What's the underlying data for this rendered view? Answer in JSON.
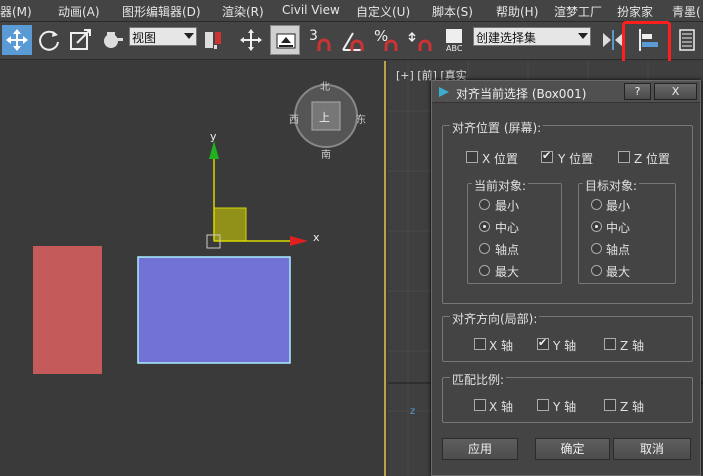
{
  "menu": [
    "器(M)",
    "动画(A)",
    "图形编辑器(D)",
    "渲染(R)",
    "Civil View",
    "自定义(U)",
    "脚本(S)",
    "帮助(H)",
    "渲梦工厂",
    "扮家家",
    "青墨("
  ],
  "toolbar": {
    "view_combo": "视图",
    "selection_set_combo": "创建选择集",
    "snap_3": "3",
    "snap_pct": "%",
    "abc_label": "ABC"
  },
  "viewport": {
    "label": "[+] [前] [真实",
    "viewcube": {
      "top": "北",
      "left": "西",
      "right": "东",
      "bottom": "南",
      "face": "上"
    },
    "axis_x": "x",
    "axis_y": "y",
    "axis_z": "z"
  },
  "dialog": {
    "title": "对齐当前选择 (Box001)",
    "help_btn": "?",
    "close_btn": "X",
    "align_position_group": "对齐位置 (屏幕):",
    "x_pos": "X 位置",
    "y_pos": "Y 位置",
    "z_pos": "Z 位置",
    "x_pos_checked": false,
    "y_pos_checked": true,
    "z_pos_checked": false,
    "current_object_group": "当前对象:",
    "target_object_group": "目标对象:",
    "current_options": [
      "最小",
      "中心",
      "轴点",
      "最大"
    ],
    "current_selected": "中心",
    "target_options": [
      "最小",
      "中心",
      "轴点",
      "最大"
    ],
    "target_selected": "中心",
    "align_orientation_group": "对齐方向(局部):",
    "orient_x": "X 轴",
    "orient_y": "Y 轴",
    "orient_z": "Z 轴",
    "orient_y_checked": true,
    "match_scale_group": "匹配比例:",
    "scale_x": "X 轴",
    "scale_y": "Y 轴",
    "scale_z": "Z 轴",
    "apply_button": "应用",
    "ok_button": "确定",
    "cancel_button": "取消"
  },
  "colors": {
    "red_box": "#c45a5a",
    "blue_box": "#7272d6",
    "highlight": "#ff1e1e",
    "gizmo_yellow": "#d8d800"
  }
}
